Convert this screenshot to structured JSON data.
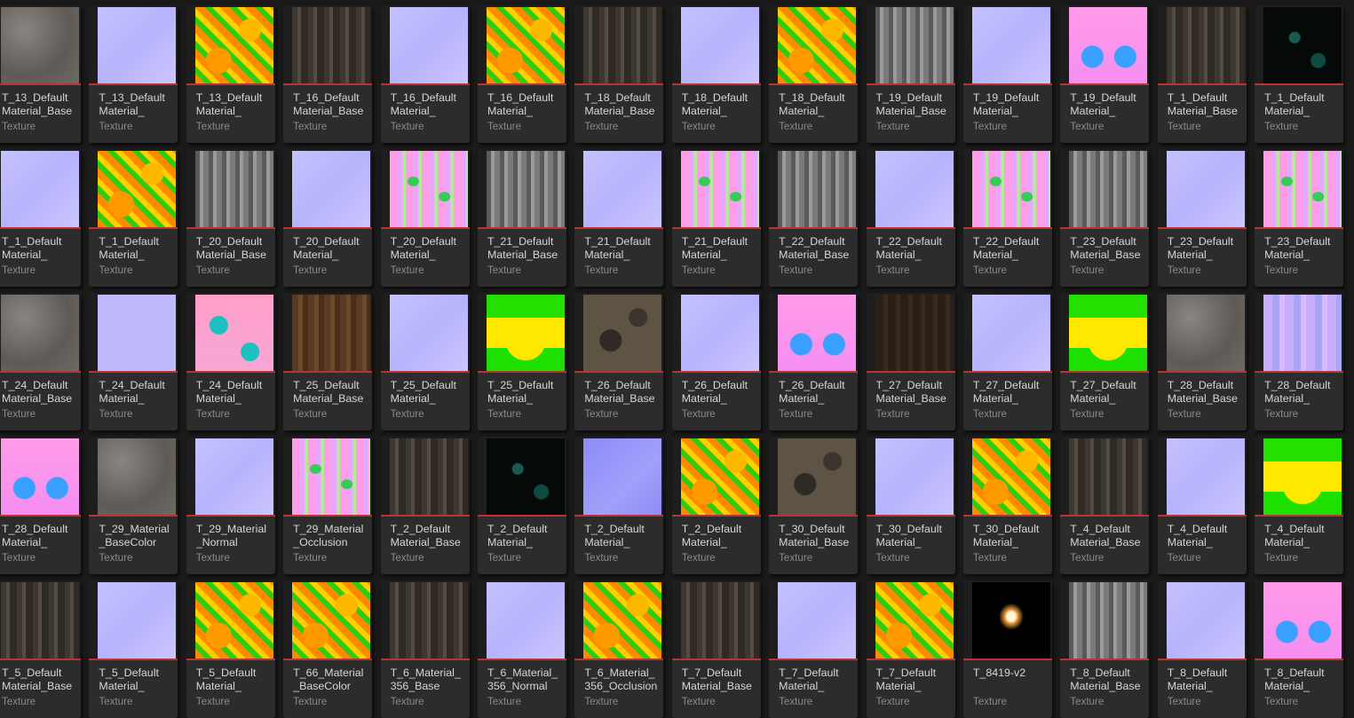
{
  "asset_type_label": "Texture",
  "accent_color": "#b93234",
  "assets": [
    {
      "name": "T_13_Default\nMaterial_Base",
      "thumb": "base-gray"
    },
    {
      "name": "T_13_Default\nMaterial_",
      "thumb": "normal"
    },
    {
      "name": "T_13_Default\nMaterial_",
      "thumb": "orm-green-orange"
    },
    {
      "name": "T_16_Default\nMaterial_Base",
      "thumb": "base-dark"
    },
    {
      "name": "T_16_Default\nMaterial_",
      "thumb": "normal"
    },
    {
      "name": "T_16_Default\nMaterial_",
      "thumb": "orm-green-orange"
    },
    {
      "name": "T_18_Default\nMaterial_Base",
      "thumb": "base-dark"
    },
    {
      "name": "T_18_Default\nMaterial_",
      "thumb": "normal"
    },
    {
      "name": "T_18_Default\nMaterial_",
      "thumb": "orm-green-orange"
    },
    {
      "name": "T_19_Default\nMaterial_Base",
      "thumb": "base-light-gray"
    },
    {
      "name": "T_19_Default\nMaterial_",
      "thumb": "normal"
    },
    {
      "name": "T_19_Default\nMaterial_",
      "thumb": "orm-pink-blue"
    },
    {
      "name": "T_1_Default\nMaterial_Base",
      "thumb": "base-dark"
    },
    {
      "name": "T_1_Default\nMaterial_",
      "thumb": "base-black-teal"
    },
    {
      "name": "T_1_Default\nMaterial_",
      "thumb": "normal"
    },
    {
      "name": "T_1_Default\nMaterial_",
      "thumb": "orm-green-orange"
    },
    {
      "name": "T_20_Default\nMaterial_Base",
      "thumb": "base-light-gray"
    },
    {
      "name": "T_20_Default\nMaterial_",
      "thumb": "normal"
    },
    {
      "name": "T_20_Default\nMaterial_",
      "thumb": "orm-pink-green"
    },
    {
      "name": "T_21_Default\nMaterial_Base",
      "thumb": "base-light-gray"
    },
    {
      "name": "T_21_Default\nMaterial_",
      "thumb": "normal"
    },
    {
      "name": "T_21_Default\nMaterial_",
      "thumb": "orm-pink-green"
    },
    {
      "name": "T_22_Default\nMaterial_Base",
      "thumb": "base-light-gray"
    },
    {
      "name": "T_22_Default\nMaterial_",
      "thumb": "normal"
    },
    {
      "name": "T_22_Default\nMaterial_",
      "thumb": "orm-pink-green"
    },
    {
      "name": "T_23_Default\nMaterial_Base",
      "thumb": "base-light-gray"
    },
    {
      "name": "T_23_Default\nMaterial_",
      "thumb": "normal"
    },
    {
      "name": "T_23_Default\nMaterial_",
      "thumb": "orm-pink-green"
    },
    {
      "name": "T_24_Default\nMaterial_Base",
      "thumb": "base-gray"
    },
    {
      "name": "T_24_Default\nMaterial_",
      "thumb": "normal-flat"
    },
    {
      "name": "T_24_Default\nMaterial_",
      "thumb": "orm-pink-teal"
    },
    {
      "name": "T_25_Default\nMaterial_Base",
      "thumb": "base-brown"
    },
    {
      "name": "T_25_Default\nMaterial_",
      "thumb": "normal"
    },
    {
      "name": "T_25_Default\nMaterial_",
      "thumb": "orm-yellow-green"
    },
    {
      "name": "T_26_Default\nMaterial_Base",
      "thumb": "base-dark-brown"
    },
    {
      "name": "T_26_Default\nMaterial_",
      "thumb": "normal"
    },
    {
      "name": "T_26_Default\nMaterial_",
      "thumb": "orm-pink-blue"
    },
    {
      "name": "T_27_Default\nMaterial_Base",
      "thumb": "base-very-dark"
    },
    {
      "name": "T_27_Default\nMaterial_",
      "thumb": "normal"
    },
    {
      "name": "T_27_Default\nMaterial_",
      "thumb": "orm-yellow-green"
    },
    {
      "name": "T_28_Default\nMaterial_Base",
      "thumb": "base-gray"
    },
    {
      "name": "T_28_Default\nMaterial_",
      "thumb": "normal-purple"
    },
    {
      "name": "T_28_Default\nMaterial_",
      "thumb": "orm-pink-blue"
    },
    {
      "name": "T_29_Material\n_BaseColor",
      "thumb": "base-gray"
    },
    {
      "name": "T_29_Material\n_Normal",
      "thumb": "normal"
    },
    {
      "name": "T_29_Material\n_Occlusion",
      "thumb": "orm-pink-green"
    },
    {
      "name": "T_2_Default\nMaterial_Base",
      "thumb": "base-dark"
    },
    {
      "name": "T_2_Default\nMaterial_",
      "thumb": "base-black-teal"
    },
    {
      "name": "T_2_Default\nMaterial_",
      "thumb": "normal-blue"
    },
    {
      "name": "T_2_Default\nMaterial_",
      "thumb": "orm-green-orange"
    },
    {
      "name": "T_30_Default\nMaterial_Base",
      "thumb": "base-dark-brown"
    },
    {
      "name": "T_30_Default\nMaterial_",
      "thumb": "normal"
    },
    {
      "name": "T_30_Default\nMaterial_",
      "thumb": "orm-green-orange"
    },
    {
      "name": "T_4_Default\nMaterial_Base",
      "thumb": "base-dark"
    },
    {
      "name": "T_4_Default\nMaterial_",
      "thumb": "normal"
    },
    {
      "name": "T_4_Default\nMaterial_",
      "thumb": "orm-yellow-green"
    },
    {
      "name": "T_5_Default\nMaterial_Base",
      "thumb": "base-dark"
    },
    {
      "name": "T_5_Default\nMaterial_",
      "thumb": "normal"
    },
    {
      "name": "T_5_Default\nMaterial_",
      "thumb": "orm-green-orange"
    },
    {
      "name": "T_66_Material\n_BaseColor",
      "thumb": "orm-green-orange"
    },
    {
      "name": "T_6_Material_\n356_Base",
      "thumb": "base-dark"
    },
    {
      "name": "T_6_Material_\n356_Normal",
      "thumb": "normal"
    },
    {
      "name": "T_6_Material_\n356_Occlusion",
      "thumb": "orm-green-orange"
    },
    {
      "name": "T_7_Default\nMaterial_Base",
      "thumb": "base-dark"
    },
    {
      "name": "T_7_Default\nMaterial_",
      "thumb": "normal"
    },
    {
      "name": "T_7_Default\nMaterial_",
      "thumb": "orm-green-orange"
    },
    {
      "name": "T_8419-v2\n",
      "thumb": "flame"
    },
    {
      "name": "T_8_Default\nMaterial_Base",
      "thumb": "base-light-gray"
    },
    {
      "name": "T_8_Default\nMaterial_",
      "thumb": "normal"
    },
    {
      "name": "T_8_Default\nMaterial_",
      "thumb": "orm-pink-blue"
    }
  ]
}
